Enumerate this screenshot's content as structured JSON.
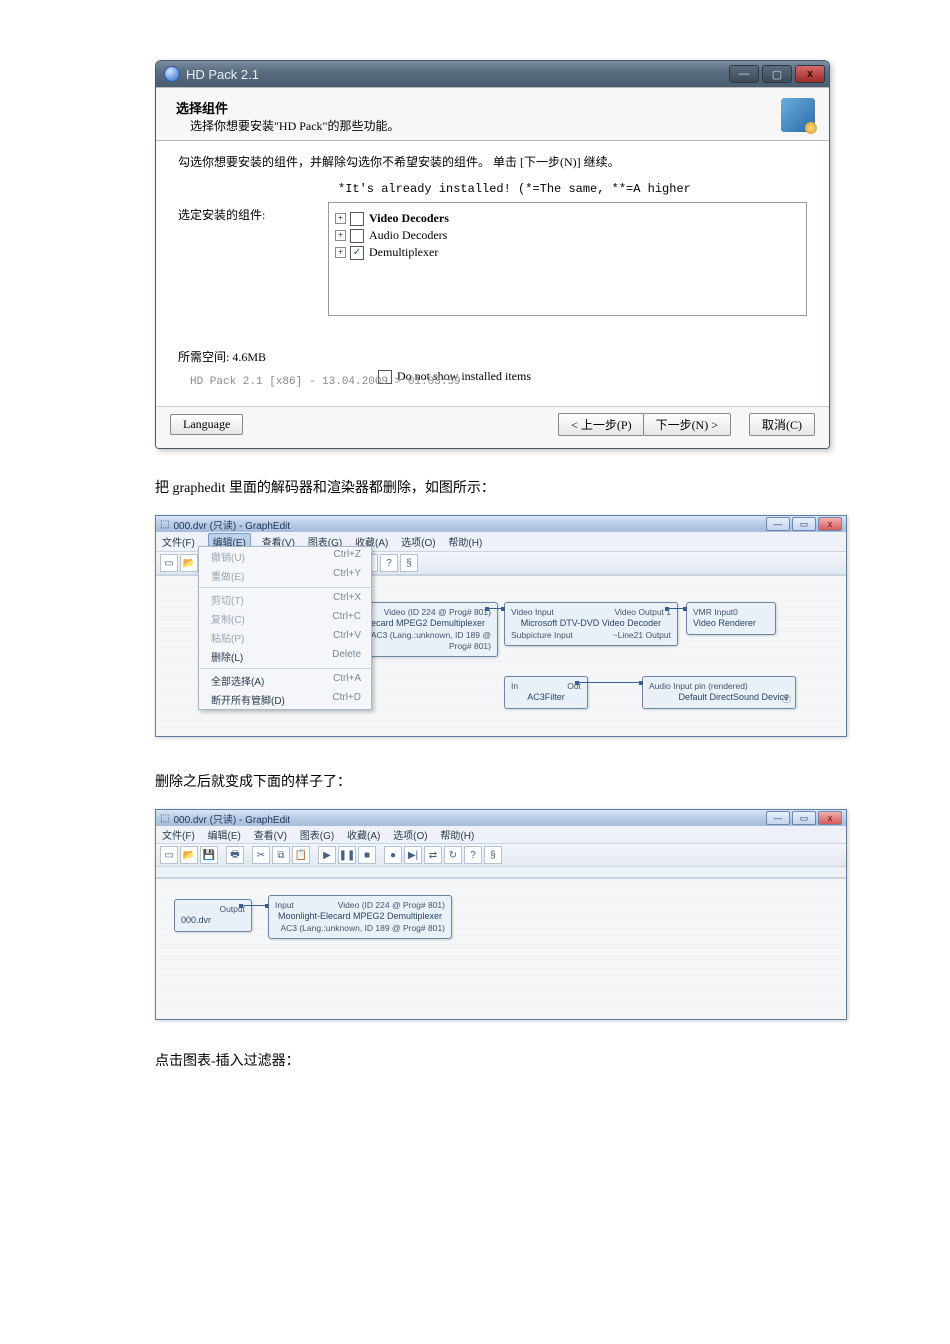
{
  "installer": {
    "title": "HD Pack 2.1",
    "heading": "选择组件",
    "subheading": "选择你想要安装\"HD Pack\"的那些功能。",
    "instruction": "勾选你想要安装的组件，并解除勾选你不希望安装的组件。 单击 [下一步(N)] 继续。",
    "already_note": "*It's already installed! (*=The same, **=A higher",
    "select_label": "选定安装的组件:",
    "tree": {
      "video": "Video Decoders",
      "audio": "Audio Decoders",
      "demux": "Demultiplexer"
    },
    "space_label": "所需空间: 4.6MB",
    "show_installed": "Do not show installed items",
    "version": "HD Pack 2.1 [x86] - 13.04.2009 > 01:03:59",
    "btn_lang": "Language",
    "btn_prev": "< 上一步(P)",
    "btn_next": "下一步(N) >",
    "btn_cancel": "取消(C)"
  },
  "para1": "把 graphedit 里面的解码器和渲染器都删除，如图所示：",
  "para2": "删除之后就变成下面的样子了：",
  "para3": "点击图表-插入过滤器：",
  "graphedit": {
    "title": "000.dvr (只读) - GraphEdit",
    "menus": [
      "文件(F)",
      "编辑(E)",
      "查看(V)",
      "图表(G)",
      "收藏(A)",
      "选项(O)",
      "帮助(H)"
    ],
    "edit_menu": {
      "undo": {
        "label": "撤销(U)",
        "sc": "Ctrl+Z"
      },
      "redo": {
        "label": "重做(E)",
        "sc": "Ctrl+Y"
      },
      "cut": {
        "label": "剪切(T)",
        "sc": "Ctrl+X"
      },
      "copy": {
        "label": "复制(C)",
        "sc": "Ctrl+C"
      },
      "paste": {
        "label": "粘贴(P)",
        "sc": "Ctrl+V"
      },
      "delete": {
        "label": "删除(L)",
        "sc": "Delete"
      },
      "selall": {
        "label": "全部选择(A)",
        "sc": "Ctrl+A"
      },
      "discon": {
        "label": "断开所有管脚(D)",
        "sc": "Ctrl+D"
      }
    },
    "filters": {
      "demux_name": "Elecard MPEG2 Demultiplexer",
      "demux_p1": "Video (ID 224 @ Prog# 801)",
      "demux_p2": "AC3 (Lang.:unknown, ID 189 @ Prog# 801)",
      "dec_in": "Video Input",
      "dec_sub": "Subpicture Input",
      "dec_name": "Microsoft DTV-DVD Video Decoder",
      "dec_out1": "Video Output 1",
      "dec_out2": "~Line21 Output",
      "vmr_in": "VMR Input0",
      "vmr_name": "Video Renderer",
      "ac3_in": "In",
      "ac3_name": "AC3Filter",
      "ac3_out": "Out",
      "snd_in": "Audio Input pin (rendered)",
      "snd_name": "Default DirectSound Device",
      "src_name": "000.dvr",
      "src_out": "Output",
      "mdx_in": "Input",
      "mdx_name": "Moonlight-Elecard MPEG2 Demultiplexer"
    }
  }
}
